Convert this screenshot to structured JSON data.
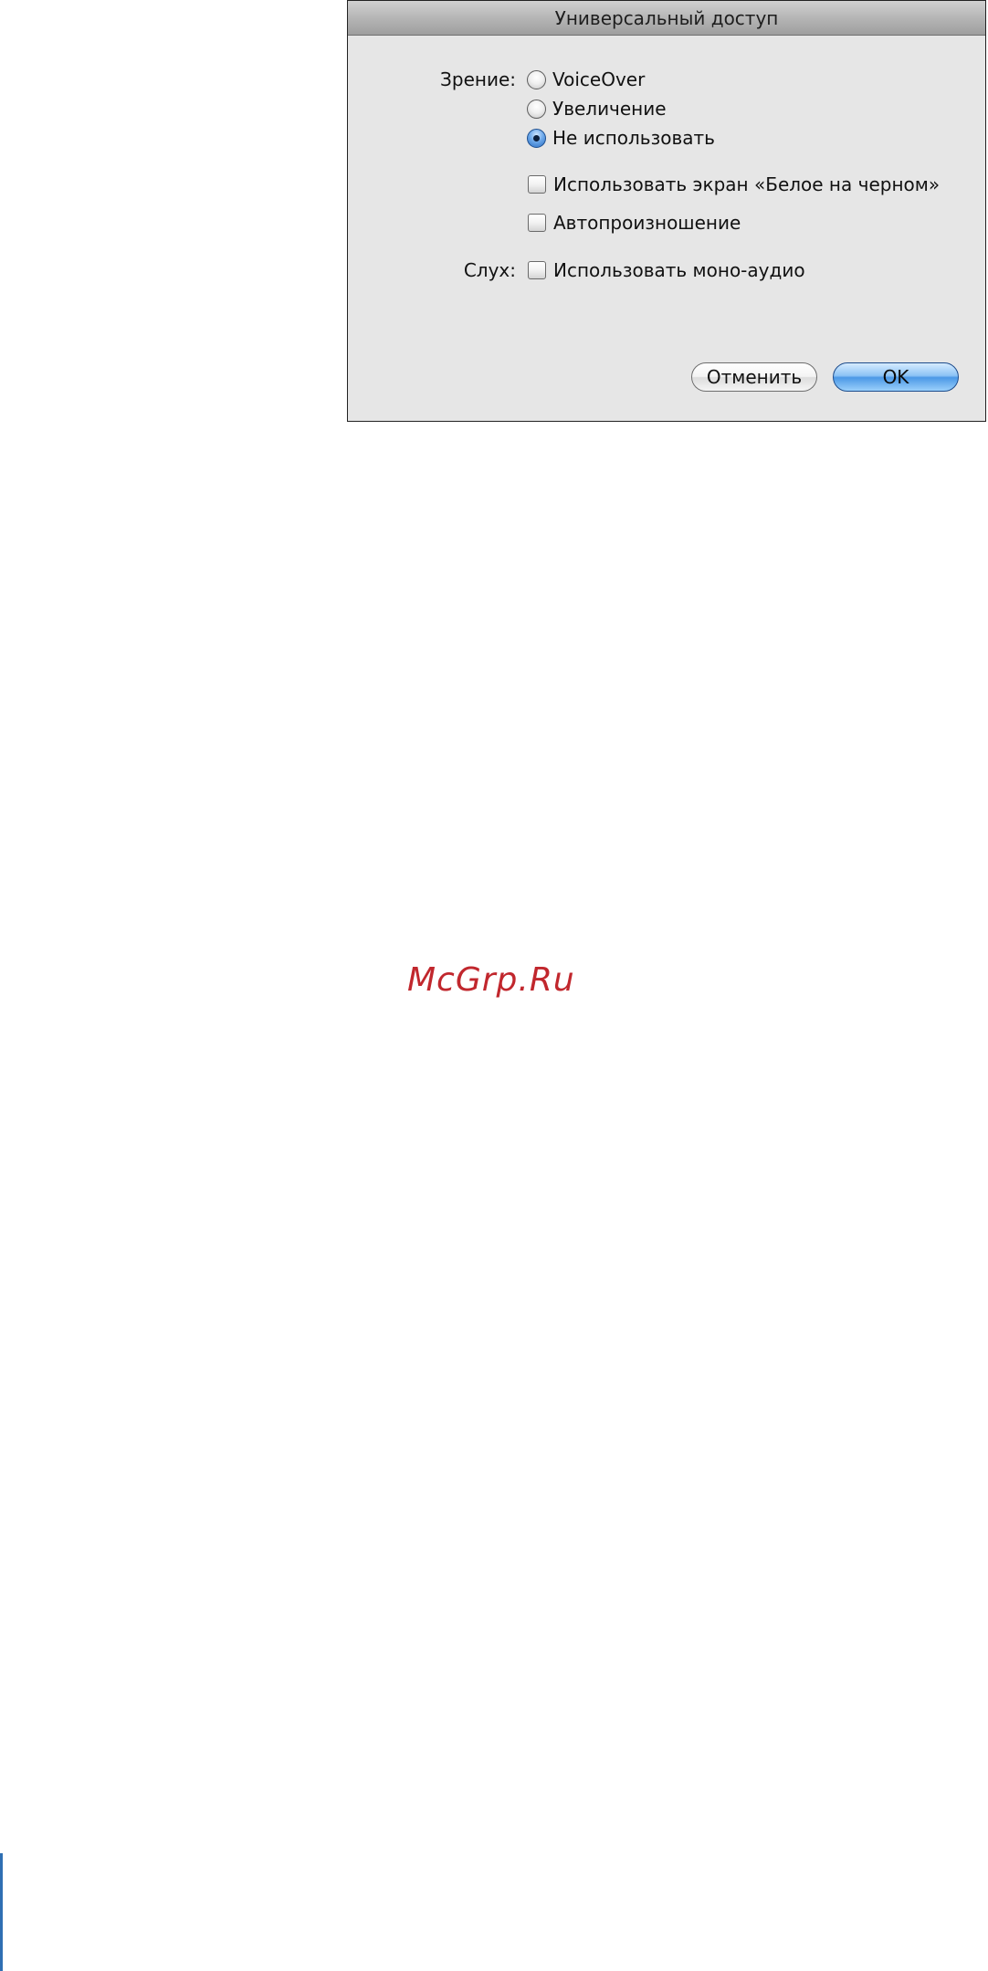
{
  "dialog": {
    "title": "Универсальный доступ",
    "vision": {
      "label": "Зрение:",
      "options": [
        {
          "label": "VoiceOver",
          "selected": false
        },
        {
          "label": "Увеличение",
          "selected": false
        },
        {
          "label": "Не использовать",
          "selected": true
        }
      ]
    },
    "checkboxes": [
      {
        "label": "Использовать экран «Белое на черном»",
        "checked": false
      },
      {
        "label": "Автопроизношение",
        "checked": false
      }
    ],
    "hearing": {
      "label": "Слух:",
      "checkbox": {
        "label": "Использовать моно-аудио",
        "checked": false
      }
    },
    "buttons": {
      "cancel": "Отменить",
      "ok": "OK"
    }
  },
  "watermark": "McGrp.Ru",
  "colors": {
    "accent_blue": "#4b98e6",
    "watermark_red": "#c1272d",
    "dialog_bg": "#e6e6e6"
  }
}
